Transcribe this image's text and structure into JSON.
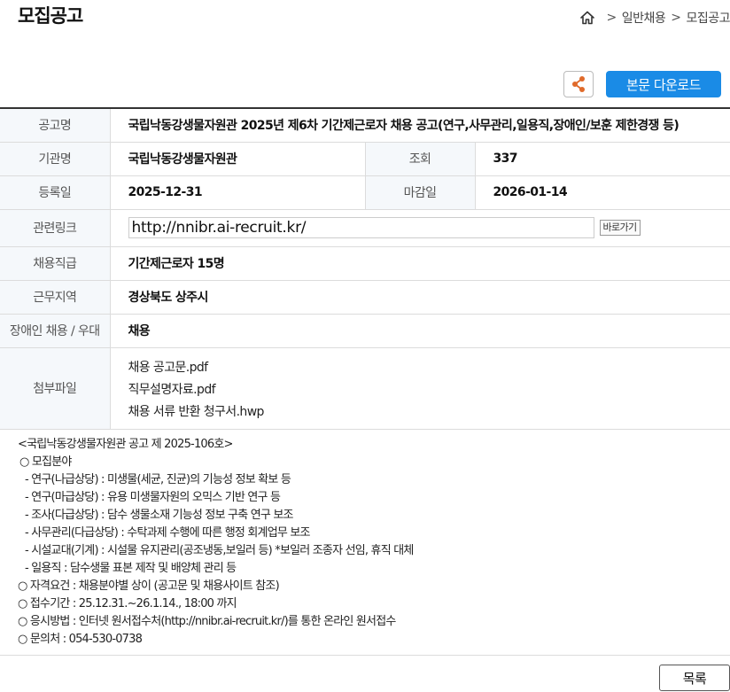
{
  "page": {
    "title": "모집공고",
    "breadcrumb": [
      "일반채용",
      "모집공고"
    ],
    "breadcrumb_sep": ">",
    "share_icon": "share-icon",
    "download_label": "본문 다운로드",
    "list_label": "목록"
  },
  "info": {
    "labels": {
      "title": "공고명",
      "org": "기관명",
      "views": "조회",
      "registered": "등록일",
      "deadline": "마감일",
      "link": "관련링크",
      "position": "채용직급",
      "region": "근무지역",
      "disabled": "장애인 채용 / 우대",
      "attachments": "첨부파일"
    },
    "title": "국립낙동강생물자원관 2025년 제6차 기간제근로자 채용 공고(연구,사무관리,일용직,장애인/보훈 제한경쟁 등)",
    "org": "국립낙동강생물자원관",
    "views": "337",
    "registered": "2025-12-31",
    "deadline": "2026-01-14",
    "link": "http://nnibr.ai-recruit.kr/",
    "go_label": "바로가기",
    "position": "기간제근로자 15명",
    "region": "경상북도 상주시",
    "disabled": "채용",
    "files": [
      "채용 공고문.pdf",
      "직무설명자료.pdf",
      "채용 서류 반환 청구서.hwp"
    ]
  },
  "notice": [
    "<국립낙동강생물자원관 공고 제 2025-106호>",
    "○ 모집분야",
    "- 연구(나급상당) : 미생물(세균, 진균)의 기능성 정보 확보 등",
    "- 연구(마급상당) : 유용 미생물자원의 오믹스 기반 연구 등",
    "- 조사(다급상당) : 담수 생물소재 기능성 정보 구축 연구 보조",
    "- 사무관리(다급상당) : 수탁과제 수행에 따른 행정 회계업무 보조",
    "- 시설교대(기계) : 시설물 유지관리(공조냉동,보일러 등) *보일러 조종자 선임, 휴직 대체",
    "- 일용직 : 담수생물 표본 제작 및 배양체 관리 등",
    "○ 자격요건 : 채용분야별 상이 (공고문 및 채용사이트 참조)",
    "○ 접수기간 : 25.12.31.~26.1.14., 18:00 까지",
    "○ 응시방법 : 인터넷 원서접수처(http://nnibr.ai-recruit.kr/)를 통한 온라인 원서접수",
    "○ 문의처 : 054-530-0738"
  ],
  "colors": {
    "accent": "#1a8be6",
    "header_bg": "#f5f8fb",
    "share_icon": "#e06a2a"
  }
}
